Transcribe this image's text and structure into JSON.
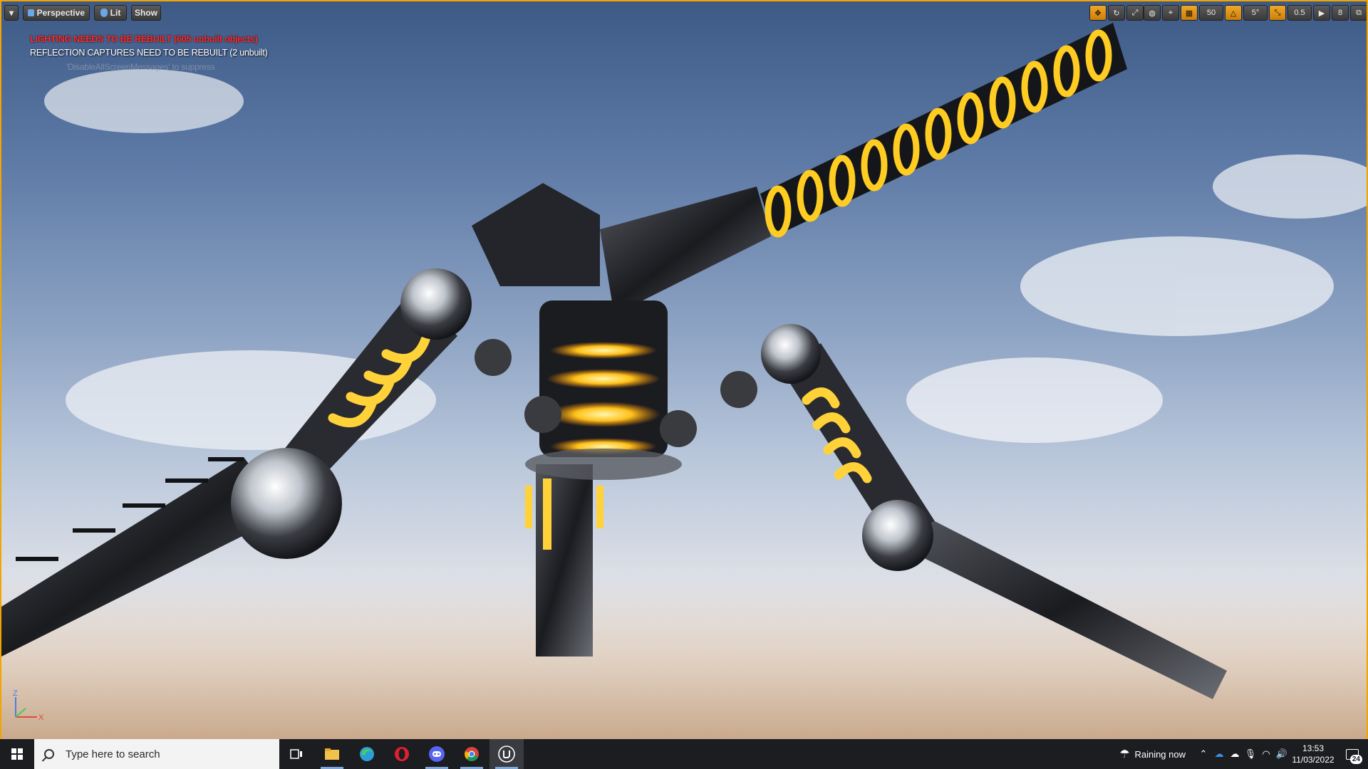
{
  "viewport": {
    "menu_arrow": "▾",
    "perspective_label": "Perspective",
    "lit_label": "Lit",
    "show_label": "Show",
    "grid_snap_value": "50",
    "rotation_snap_value": "5°",
    "scale_snap_value": "0.5",
    "camera_speed_value": "8",
    "accent_color": "#f2a500",
    "axis_x_label": "X",
    "axis_z_label": "Z"
  },
  "messages": {
    "lighting": "LIGHTING NEEDS TO BE REBUILT (605 unbuilt objects)",
    "reflection": "REFLECTION CAPTURES NEED TO BE REBUILT (2 unbuilt)",
    "suppress_hint": "'DisableAllScreenMessages' to suppress"
  },
  "taskbar": {
    "search_placeholder": "Type here to search",
    "weather_text": "Raining now",
    "time": "13:53",
    "date": "11/03/2022",
    "notification_count": "24",
    "apps": [
      "task-view",
      "file-explorer",
      "edge",
      "opera",
      "discord",
      "chrome",
      "unreal-engine"
    ]
  }
}
